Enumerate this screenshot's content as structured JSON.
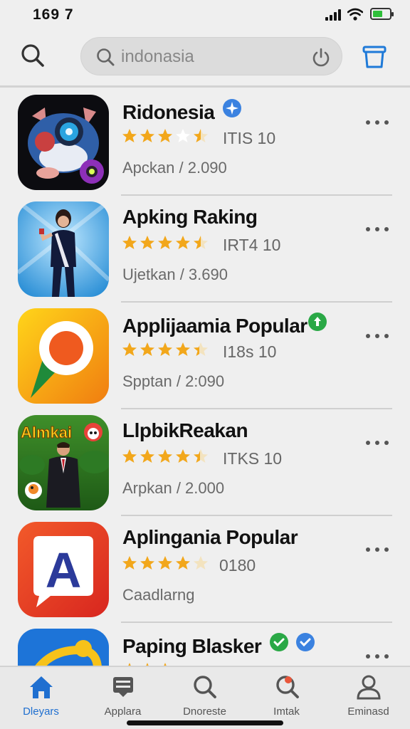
{
  "status_bar": {
    "time": "169 7"
  },
  "search": {
    "value": "indonasia"
  },
  "apps": [
    {
      "name": "Ridonesia",
      "badge": "blue-check",
      "stars": 3.5,
      "rating_label": "ITIS 10",
      "meta": "Apckan / 2.090"
    },
    {
      "name": "Apking Raking",
      "badge": "",
      "stars": 4.5,
      "rating_label": "IRT4 10",
      "meta": "Ujetkan / 3.690"
    },
    {
      "name": "Applijaamia Popular",
      "badge": "green-arrow",
      "stars": 4.5,
      "rating_label": "I18s 10",
      "meta": "Spptan / 2:090"
    },
    {
      "name": "LlpbikReakan",
      "badge": "",
      "stars": 4.5,
      "rating_label": "ITKS 10",
      "meta": "Arpkan / 2.000",
      "icon_text": "Almkai"
    },
    {
      "name": "Aplingania Popular",
      "badge": "",
      "stars": 4,
      "rating_label": "0180",
      "meta": "Caadlarng",
      "icon_text": "A"
    },
    {
      "name": "Paping Blasker",
      "badge": "green-check,blue-check",
      "stars": 4,
      "rating_label": "",
      "meta": ""
    }
  ],
  "tabs": [
    {
      "label": "Dleyars",
      "icon": "home-icon",
      "active": true
    },
    {
      "label": "Applara",
      "icon": "inbox-icon",
      "active": false
    },
    {
      "label": "Dnoreste",
      "icon": "search-icon",
      "active": false
    },
    {
      "label": "Imtak",
      "icon": "search-badge-icon",
      "active": false
    },
    {
      "label": "Eminasd",
      "icon": "person-icon",
      "active": false
    }
  ],
  "colors": {
    "accent": "#1f6fd0",
    "star": "#f2a71b",
    "divider": "#cfcfcf",
    "background": "#efefef"
  }
}
